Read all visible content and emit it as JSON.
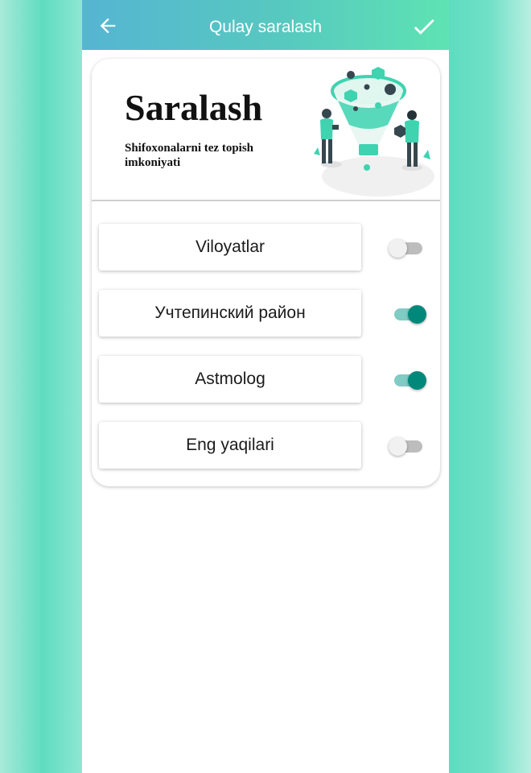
{
  "appbar": {
    "title": "Qulay saralash",
    "back_icon": "arrow-left-icon",
    "confirm_icon": "check-icon"
  },
  "header": {
    "title": "Saralash",
    "subtitle": "Shifoxonalarni tez topish imkoniyati",
    "illustration": "funnel-filter-illustration"
  },
  "options": [
    {
      "label": "Viloyatlar",
      "enabled": false
    },
    {
      "label": "Учтепинский район",
      "enabled": true
    },
    {
      "label": "Astmolog",
      "enabled": true
    },
    {
      "label": "Eng yaqilari",
      "enabled": false
    }
  ],
  "colors": {
    "appbar_start": "#56b5d2",
    "appbar_end": "#5ee3b3",
    "switch_on": "#00897b",
    "switch_on_track": "#80cbc4",
    "switch_off": "#f1f1f1",
    "illustration_accent": "#3fd3b0",
    "illustration_dark": "#37474f"
  }
}
